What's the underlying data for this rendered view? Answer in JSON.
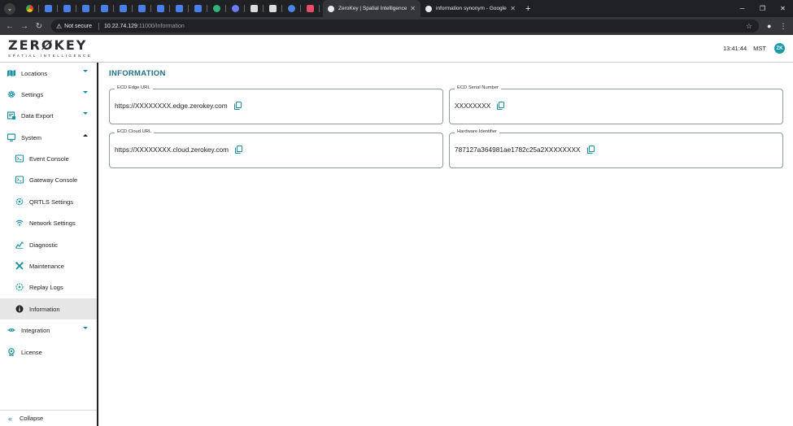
{
  "browser": {
    "tabs": [
      {
        "title": "ZeroKey | Spatial Intelligence Pl",
        "active": true,
        "favicon_color": "#e8eaed"
      },
      {
        "title": "information synonym - Google Se",
        "active": false,
        "favicon_color": "#e8eaed"
      }
    ],
    "address": {
      "security_label": "Not secure",
      "host": "10.22.74.129",
      "path": ":11000/Information"
    }
  },
  "header": {
    "logo_text": "ZERØKEY",
    "logo_tagline": "SPATIAL INTELLIGENCE",
    "time": "13:41:44",
    "timezone": "MST",
    "avatar_initials": "ZK"
  },
  "sidebar": {
    "items": [
      {
        "label": "Locations",
        "icon": "map-icon"
      },
      {
        "label": "Settings",
        "icon": "gear-icon"
      },
      {
        "label": "Data Export",
        "icon": "export-icon"
      },
      {
        "label": "System",
        "icon": "monitor-icon"
      },
      {
        "label": "Event Console",
        "icon": "console-icon"
      },
      {
        "label": "Gateway Console",
        "icon": "console-icon"
      },
      {
        "label": "QRTLS Settings",
        "icon": "qrtls-icon"
      },
      {
        "label": "Network Settings",
        "icon": "wifi-icon"
      },
      {
        "label": "Diagnostic",
        "icon": "diagnostic-icon"
      },
      {
        "label": "Maintenance",
        "icon": "tools-icon"
      },
      {
        "label": "Replay Logs",
        "icon": "replay-icon"
      },
      {
        "label": "Information",
        "icon": "info-icon"
      },
      {
        "label": "Integration",
        "icon": "integration-icon"
      },
      {
        "label": "License",
        "icon": "license-icon"
      }
    ],
    "collapse_label": "Collapse"
  },
  "page": {
    "title": "INFORMATION",
    "fields": {
      "edge_url": {
        "label": "ECD Edge URL",
        "value": "https://XXXXXXXX.edge.zerokey.com"
      },
      "serial": {
        "label": "ECD Serial Number",
        "value": "XXXXXXXX"
      },
      "cloud_url": {
        "label": "ECD Cloud URL",
        "value": "https://XXXXXXXX.cloud.zerokey.com"
      },
      "hardware_id": {
        "label": "Hardware Identifier",
        "value": "787127a364981ae1782c25a2XXXXXXXX"
      }
    }
  },
  "colors": {
    "accent": "#1c6f86",
    "teal": "#1a8fa0",
    "active_item_bg": "#e6e6e6"
  }
}
